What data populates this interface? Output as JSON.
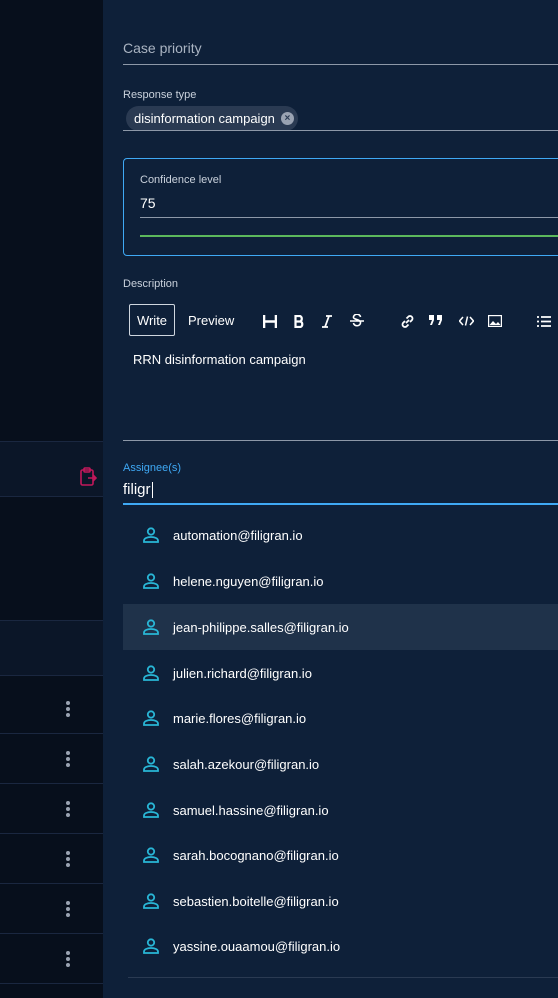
{
  "form": {
    "case_priority_label": "Case priority",
    "response_type_label": "Response type",
    "response_type_chip": "disinformation campaign",
    "confidence_label": "Confidence level",
    "confidence_value": "75",
    "description_label": "Description",
    "tab_write": "Write",
    "tab_preview": "Preview",
    "toolbar": [
      "heading-icon",
      "bold-icon",
      "italic-icon",
      "strikethrough-icon",
      "link-icon",
      "quote-icon",
      "code-icon",
      "image-icon",
      "list-icon"
    ],
    "description_text": "RRN disinformation campaign",
    "assignee_label": "Assignee(s)",
    "assignee_input": "filigr"
  },
  "assignee_options": [
    "automation@filigran.io",
    "helene.nguyen@filigran.io",
    "jean-philippe.salles@filigran.io",
    "julien.richard@filigran.io",
    "marie.flores@filigran.io",
    "salah.azekour@filigran.io",
    "samuel.hassine@filigran.io",
    "sarah.bocognano@filigran.io",
    "sebastien.boitelle@filigran.io",
    "yassine.ouaamou@filigran.io"
  ],
  "highlighted_option_index": 2,
  "colors": {
    "accent": "#3fa9f5",
    "confidence_bar": "#5cb85c",
    "user_icon": "#29b6d6"
  }
}
